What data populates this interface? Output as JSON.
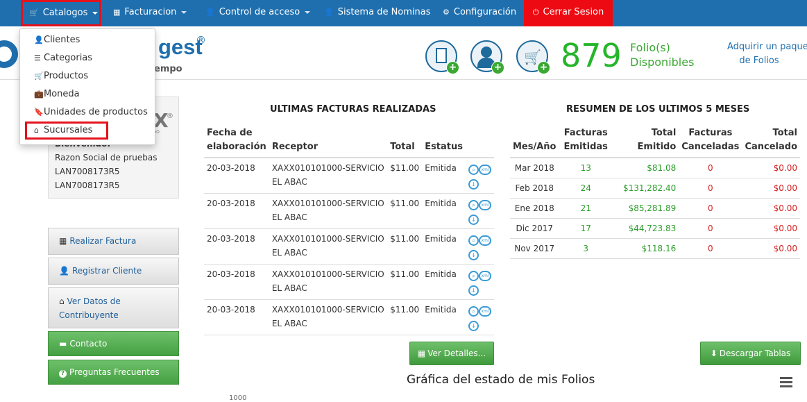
{
  "nav": {
    "catalogos": "Catalogos",
    "facturacion": "Facturacion",
    "control": "Control de acceso",
    "nominas": "Sistema de Nominas",
    "config": "Configuración",
    "cerrar": "Cerrar Sesion"
  },
  "dropdown": [
    "Clientes",
    "Categorias",
    "Productos",
    "Moneda",
    "Unidades de productos",
    "Sucursales"
  ],
  "header": {
    "logo_text": "gest",
    "registered": "®",
    "tagline": "empo",
    "folios": "879",
    "folio_label_1": "Folio(s)",
    "folio_label_2": "Disponibles",
    "adquirir_1": "Adquirir un paquete",
    "adquirir_2": "de Folios"
  },
  "user": {
    "logo_partial": "X",
    "logo_reg": "®",
    "logo_small": "NDO",
    "welcome": "Bienvenido:",
    "razon": "Razon Social de pruebas",
    "rfc1": "LAN7008173R5",
    "rfc2": "LAN7008173R5"
  },
  "side_buttons": {
    "realizar": "Realizar Factura",
    "registrar": "Registrar Cliente",
    "ver_datos_1": "Ver Datos de",
    "ver_datos_2": "Contribuyente",
    "contacto": "Contacto",
    "preguntas": "Preguntas Frecuentes"
  },
  "facturas": {
    "title": "ULTIMAS FACTURAS REALIZADAS",
    "headers": [
      "Fecha de elaboración",
      "Receptor",
      "Total",
      "Estatus"
    ],
    "rows": [
      {
        "fecha": "20-03-2018",
        "receptor": "XAXX010101000-SERVICIO EL ABAC",
        "total": "$11.00",
        "estatus": "Emitida"
      },
      {
        "fecha": "20-03-2018",
        "receptor": "XAXX010101000-SERVICIO EL ABAC",
        "total": "$11.00",
        "estatus": "Emitida"
      },
      {
        "fecha": "20-03-2018",
        "receptor": "XAXX010101000-SERVICIO EL ABAC",
        "total": "$11.00",
        "estatus": "Emitida"
      },
      {
        "fecha": "20-03-2018",
        "receptor": "XAXX010101000-SERVICIO EL ABAC",
        "total": "$11.00",
        "estatus": "Emitida"
      },
      {
        "fecha": "20-03-2018",
        "receptor": "XAXX010101000-SERVICIO EL ABAC",
        "total": "$11.00",
        "estatus": "Emitida"
      }
    ],
    "ver_detalles": "Ver Detalles..."
  },
  "resumen": {
    "title": "RESUMEN DE LOS ULTIMOS 5 MESES",
    "headers": [
      "Mes/Año",
      "Facturas Emitidas",
      "Total Emitido",
      "Facturas Canceladas",
      "Total Cancelado"
    ],
    "rows": [
      {
        "mes": "Mar 2018",
        "emitidas": "13",
        "total": "$81.08",
        "canceladas": "0",
        "cancelado": "$0.00"
      },
      {
        "mes": "Feb 2018",
        "emitidas": "24",
        "total": "$131,282.40",
        "canceladas": "0",
        "cancelado": "$0.00"
      },
      {
        "mes": "Ene 2018",
        "emitidas": "21",
        "total": "$85,281.89",
        "canceladas": "0",
        "cancelado": "$0.00"
      },
      {
        "mes": "Dic 2017",
        "emitidas": "17",
        "total": "$44,723.83",
        "canceladas": "0",
        "cancelado": "$0.00"
      },
      {
        "mes": "Nov 2017",
        "emitidas": "3",
        "total": "$118.16",
        "canceladas": "0",
        "cancelado": "$0.00"
      }
    ],
    "descargar": "Descargar Tablas"
  },
  "grafica": {
    "title": "Gráfica del estado de mis Folios",
    "partial_tick": "1000"
  }
}
